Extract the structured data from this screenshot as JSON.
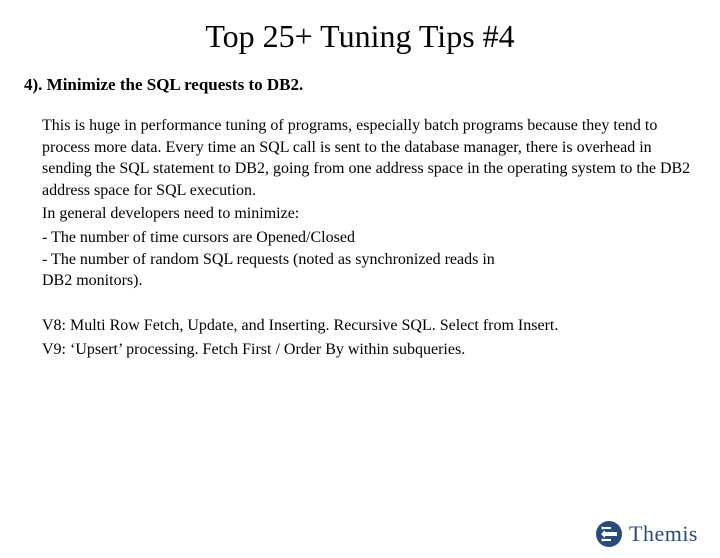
{
  "title": "Top 25+ Tuning Tips #4",
  "heading": "4). Minimize the SQL requests to DB2.",
  "paragraph1": "This is huge in performance tuning of programs, especially batch programs because they tend to process more data.  Every time an SQL call is sent to the database manager, there is overhead in sending the SQL statement to DB2, going from one address space in the operating system to the DB2 address space for SQL  execution.",
  "paragraph2": "In general developers need to minimize:",
  "bullet1": "-  The number of time cursors are Opened/Closed",
  "bullet2": "-  The number of random SQL requests (noted as synchronized reads in",
  "bullet2_cont": "   DB2 monitors).",
  "footnote1": "V8: Multi Row Fetch, Update, and Inserting.  Recursive SQL. Select from Insert.",
  "footnote2": "V9: ‘Upsert’ processing. Fetch First / Order By within subqueries.",
  "logo_text": "Themis"
}
